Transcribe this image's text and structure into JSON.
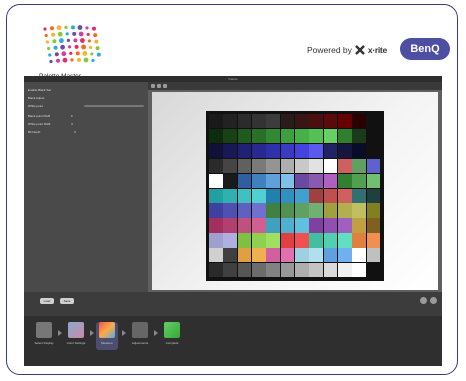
{
  "branding": {
    "product_name": "Palette Master",
    "powered_by": "Powered by",
    "xrite": "x·rite",
    "benq": "BenQ"
  },
  "app": {
    "window_title": "Palette",
    "left_panel": [
      {
        "label": "Enable Black Sat",
        "type": "checkbox"
      },
      {
        "label": "Black Adjust",
        "type": "radio"
      },
      {
        "label": "White point",
        "type": "slider"
      },
      {
        "label": "Black point RGB",
        "type": "value",
        "value": "0"
      },
      {
        "label": "White point RGB",
        "type": "value",
        "value": "0"
      },
      {
        "label": "Bit Depth",
        "type": "value",
        "value": "0"
      }
    ],
    "bottom_buttons": [
      "Load",
      "Save"
    ],
    "workflow": [
      "Select Display",
      "Color Settings",
      "Measure",
      "Adjustments",
      "Complete"
    ]
  },
  "colors": {
    "frame_border": "#3a3a82",
    "benq_badge": "#4d4fa4"
  },
  "patch_colors": [
    [
      "#1a1a1a",
      "#222",
      "#2b2b2b",
      "#333",
      "#3c3c3c",
      "#2a1c1c",
      "#3a1515",
      "#4a1010",
      "#5a0a0a",
      "#660000",
      "#2a0000",
      "#111"
    ],
    [
      "#0d2b0d",
      "#164216",
      "#1f5a1f",
      "#287028",
      "#338833",
      "#3d9f3d",
      "#48b048",
      "#55c055",
      "#66d066",
      "#2f7f2f",
      "#1a3a1a",
      "#111"
    ],
    [
      "#10103a",
      "#181857",
      "#202074",
      "#282890",
      "#3030aa",
      "#3a3ac4",
      "#4444dd",
      "#5a5aee",
      "#222266",
      "#151540",
      "#0a0a2a",
      "#111"
    ],
    [
      "#2a2a2a",
      "#454545",
      "#606060",
      "#7a7a7a",
      "#949494",
      "#aeaeae",
      "#c8c8c8",
      "#e2e2e2",
      "#ffffff",
      "#d06060",
      "#60a060",
      "#6060d0"
    ],
    [
      "#ffffff",
      "#1a1a1a",
      "#2f5fa0",
      "#4080c0",
      "#60a0d8",
      "#80c0e8",
      "#6a4aa0",
      "#8a5ab0",
      "#b060c0",
      "#308030",
      "#50a050",
      "#70c070"
    ],
    [
      "#20a0a0",
      "#30b0b0",
      "#40c0c0",
      "#50d0d0",
      "#2080b0",
      "#3090c0",
      "#40a0d0",
      "#a04040",
      "#c05050",
      "#d06060",
      "#307070",
      "#204040"
    ],
    [
      "#4040a0",
      "#5050b0",
      "#6060c0",
      "#7070d0",
      "#408040",
      "#509050",
      "#60a060",
      "#70b070",
      "#a0a040",
      "#b0b050",
      "#c0c060",
      "#808020"
    ],
    [
      "#a03060",
      "#b04070",
      "#c05080",
      "#d06090",
      "#40a0c0",
      "#50b0d0",
      "#60c0e0",
      "#8040a0",
      "#9050b0",
      "#a060c0",
      "#c0a040",
      "#806020"
    ],
    [
      "#a0a0d0",
      "#b0b0e0",
      "#80c040",
      "#90d050",
      "#a0e060",
      "#e04040",
      "#f05050",
      "#40c0a0",
      "#50d0b0",
      "#60e0c0",
      "#e08040",
      "#f09050"
    ],
    [
      "#d0d0d0",
      "#404040",
      "#e0a040",
      "#f0b050",
      "#d060a0",
      "#e070b0",
      "#a0d0e0",
      "#b0e0f0",
      "#60a0e0",
      "#70b0f0",
      "#ffffff",
      "#c0c0c0"
    ],
    [
      "#2a2a2a",
      "#404040",
      "#565656",
      "#6c6c6c",
      "#828282",
      "#989898",
      "#aeaeae",
      "#c4c4c4",
      "#dadada",
      "#f0f0f0",
      "#ffffff",
      "#111"
    ]
  ]
}
